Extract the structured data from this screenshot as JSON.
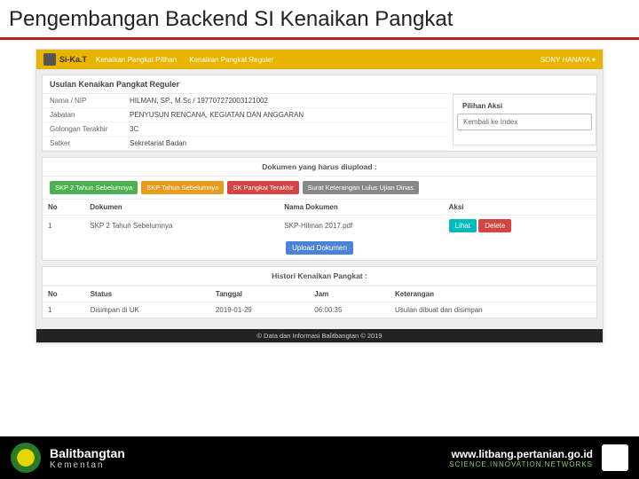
{
  "slide": {
    "title": "Pengembangan Backend SI Kenaikan Pangkat"
  },
  "app": {
    "brand": "Si-Ka.T",
    "nav1": "Kenaikan Pangkat Pilihan",
    "nav2": "Kenaikan Pangkat Reguler",
    "user": "SONY HANAYA ▾"
  },
  "page_heading": "Usulan Kenaikan Pangkat Reguler",
  "info": {
    "nama_label": "Nama / NIP",
    "nama_val": "HILMAN, SP., M.Sc / 197707272003121002",
    "jabatan_label": "Jabatan",
    "jabatan_val": "PENYUSUN RENCANA, KEGIATAN DAN ANGGARAN",
    "gol_label": "Golongan Terakhir",
    "gol_val": "3C",
    "satker_label": "Satker",
    "satker_val": "Sekretariat Badan"
  },
  "side": {
    "title": "Pilihan Aksi",
    "back": "Kembali ke Index"
  },
  "docs": {
    "heading": "Dokumen yang harus diupload :",
    "tag1": "SKP 2 Tahun Sebelumnya",
    "tag2": "SKP Tahun Sebelumnya",
    "tag3": "SK Pangkat Terakhir",
    "tag4": "Surat Keterangan Lulus Ujian Dinas",
    "th_no": "No",
    "th_dok": "Dokumen",
    "th_nama": "Nama Dokumen",
    "th_aksi": "Aksi",
    "row1_no": "1",
    "row1_dok": "SKP 2 Tahun Sebelumnya",
    "row1_nama": "SKP-Hilman 2017.pdf",
    "row1_lihat": "Lihat",
    "row1_delete": "Delete",
    "upload_btn": "Upload Dokumen"
  },
  "history": {
    "heading": "Histori Kenaikan Pangkat :",
    "th_no": "No",
    "th_status": "Status",
    "th_tgl": "Tanggal",
    "th_jam": "Jam",
    "th_ket": "Keterangan",
    "row1_no": "1",
    "row1_status": "Disimpan di UK",
    "row1_tgl": "2019-01-29",
    "row1_jam": "06:00:35",
    "row1_ket": "Usulan dibuat dan disimpan"
  },
  "app_footer": "© Data dan Informasi Balitbangtan © 2019",
  "slide_footer": {
    "org": "Balitbangtan",
    "sub": "Kementan",
    "url": "www.litbang.pertanian.go.id",
    "tag": "SCIENCE.INNOVATION.NETWORKS"
  }
}
